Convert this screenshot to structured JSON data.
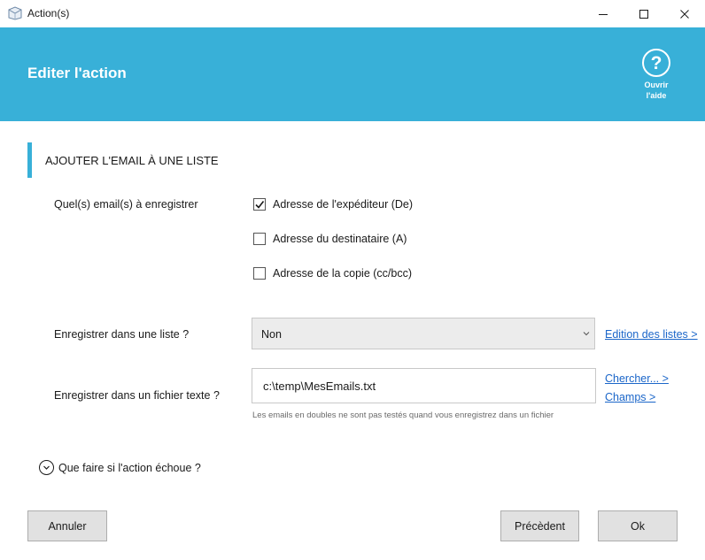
{
  "window": {
    "title": "Action(s)"
  },
  "header": {
    "title": "Editer l'action",
    "help_line1": "Ouvrir",
    "help_line2": "l'aide"
  },
  "section": {
    "title": "AJOUTER L'EMAIL À UNE LISTE"
  },
  "emails": {
    "label": "Quel(s) email(s) à enregistrer",
    "options": [
      {
        "label": "Adresse de l'expéditeur (De)",
        "checked": true
      },
      {
        "label": "Adresse du destinataire (A)",
        "checked": false
      },
      {
        "label": "Adresse de la copie (cc/bcc)",
        "checked": false
      }
    ]
  },
  "list": {
    "label": "Enregistrer dans une liste ?",
    "value": "Non",
    "link": "Edition des listes >"
  },
  "file": {
    "label": "Enregistrer dans un fichier texte ?",
    "value": "c:\\temp\\MesEmails.txt",
    "hint": "Les emails en doubles ne sont pas testés quand vous enregistrez dans un fichier",
    "link_search": "Chercher... >",
    "link_fields": "Champs >"
  },
  "failure": {
    "label": "Que faire si l'action échoue ?"
  },
  "buttons": {
    "cancel": "Annuler",
    "previous": "Précèdent",
    "ok": "Ok"
  },
  "colors": {
    "accent": "#38b0d8",
    "link": "#1b66c9"
  }
}
